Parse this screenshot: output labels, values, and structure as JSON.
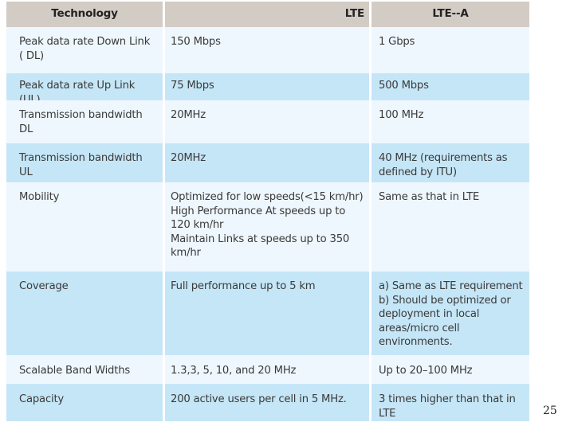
{
  "table": {
    "headers": [
      "Technology",
      "LTE",
      "LTE--A"
    ],
    "rows": [
      {
        "technology": "Peak data rate Down Link\n( DL)",
        "lte": "150 Mbps",
        "lte_a": "1 Gbps"
      },
      {
        "technology": "Peak data rate Up Link (UL)",
        "lte": "75 Mbps",
        "lte_a": "500 Mbps"
      },
      {
        "technology": "Transmission bandwidth\nDL",
        "lte": "20MHz",
        "lte_a": "100 MHz"
      },
      {
        "technology": "Transmission bandwidth\nUL",
        "lte": "20MHz",
        "lte_a": "40 MHz (requirements as\ndefined by ITU)"
      },
      {
        "technology": "Mobility",
        "lte": "Optimized for low speeds(<15 km/hr)\nHigh Performance At speeds up to\n120 km/hr\nMaintain Links at speeds up to 350\nkm/hr",
        "lte_a": "Same as that in LTE"
      },
      {
        "technology": "Coverage",
        "lte": "Full performance up to 5 km",
        "lte_a": "a) Same as LTE requirement\nb) Should be optimized or\ndeployment in local\nareas/micro cell\nenvironments."
      },
      {
        "technology": "Scalable Band Widths",
        "lte": "1.3,3, 5, 10, and 20 MHz",
        "lte_a": "Up to 20–100 MHz"
      },
      {
        "technology": "Capacity",
        "lte": "200 active users per cell in   5 MHz.",
        "lte_a": "3 times higher than that in\nLTE"
      }
    ]
  },
  "page_number": "25",
  "colors": {
    "header_bg": "#d3ccc5",
    "row_light": "#eef7fd",
    "row_dark": "#c5e6f7"
  }
}
